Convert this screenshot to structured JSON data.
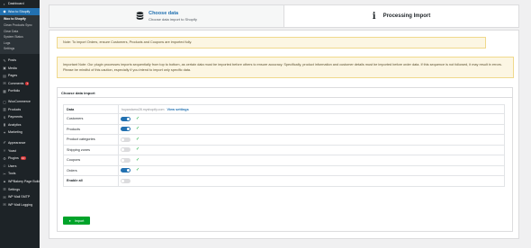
{
  "sidebar": {
    "items_top": [
      {
        "icon": "dashboard-icon",
        "glyph": "◐",
        "label": "Dashboard"
      },
      {
        "icon": "woo-to-shopify-icon",
        "glyph": "◆",
        "label": "Woo to Shopify",
        "active": true
      }
    ],
    "submenu": [
      "Woo to Shopify",
      "Clean Products Sync",
      "Clear Data",
      "System Status",
      "Logs",
      "Settings"
    ],
    "items_main": [
      {
        "icon": "posts-icon",
        "glyph": "✎",
        "label": "Posts"
      },
      {
        "icon": "media-icon",
        "glyph": "▣",
        "label": "Media"
      },
      {
        "icon": "pages-icon",
        "glyph": "▤",
        "label": "Pages"
      },
      {
        "icon": "comments-icon",
        "glyph": "✉",
        "label": "Comments",
        "badge": "7"
      },
      {
        "icon": "portfolio-icon",
        "glyph": "▦",
        "label": "Portfolio"
      }
    ],
    "items_woo": [
      {
        "icon": "woocommerce-icon",
        "glyph": "▢",
        "label": "WooCommerce"
      },
      {
        "icon": "products-icon",
        "glyph": "▥",
        "label": "Products"
      },
      {
        "icon": "payments-icon",
        "glyph": "$",
        "label": "Payments"
      },
      {
        "icon": "analytics-icon",
        "glyph": "▮",
        "label": "Analytics"
      },
      {
        "icon": "marketing-icon",
        "glyph": "✦",
        "label": "Marketing"
      }
    ],
    "items_tools": [
      {
        "icon": "appearance-icon",
        "glyph": "✐",
        "label": "Appearance"
      },
      {
        "icon": "yoast-icon",
        "glyph": "Y",
        "label": "Yoast"
      },
      {
        "icon": "plugins-icon",
        "glyph": "⚙",
        "label": "Plugins",
        "badge": "10"
      },
      {
        "icon": "users-icon",
        "glyph": "☺",
        "label": "Users"
      },
      {
        "icon": "tools-icon",
        "glyph": "✂",
        "label": "Tools"
      },
      {
        "icon": "wpbakery-icon",
        "glyph": "▲",
        "label": "WPBakery Page Builder"
      },
      {
        "icon": "settings-icon",
        "glyph": "☰",
        "label": "Settings"
      },
      {
        "icon": "wp-mail-smtp-icon",
        "glyph": "✉",
        "label": "WP Mail SMTP"
      },
      {
        "icon": "wp-mail-logging-icon",
        "glyph": "✉",
        "label": "WP Mail Logging"
      }
    ]
  },
  "wizard": {
    "step1_title": "Choose data",
    "step1_subtitle": "Choose data import to Shopify",
    "step2_title": "Processing Import"
  },
  "notices": {
    "top": "Note: To import Orders, ensure Customers, Products and Coupons are imported fully.",
    "important": "Important Note: Our plugin processes imports sequentially from top to bottom, as certain data must be imported before others to ensure accuracy. Specifically, product information and customer details must be imported before order data. If this sequence is not followed, it may result in errors. Please be mindful of this caution, especially if you intend to import only specific data."
  },
  "card": {
    "title": "Choose data import",
    "data_label": "Data",
    "site": "huyandamo28.myshopify.com",
    "view_settings": "View settings",
    "rows": [
      {
        "label": "Customers",
        "on": true,
        "checked": true
      },
      {
        "label": "Products",
        "on": true,
        "checked": true
      },
      {
        "label": "Product categories",
        "on": false,
        "checked": true
      },
      {
        "label": "Shipping zones",
        "on": false,
        "checked": true
      },
      {
        "label": "Coupons",
        "on": false,
        "checked": true
      },
      {
        "label": "Orders",
        "on": true,
        "checked": true
      }
    ],
    "enable_all": {
      "label": "Enable all",
      "on": false
    }
  },
  "import_button": "Import",
  "colors": {
    "accent": "#2271b1",
    "success": "#00a32a",
    "sidebar": "#1d2327",
    "notice_bg": "#fcf6e3"
  }
}
